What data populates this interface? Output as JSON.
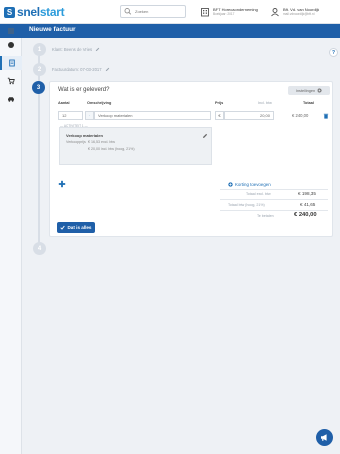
{
  "header": {
    "logo": {
      "part1": "snel",
      "part2": "start"
    },
    "search": {
      "placeholder": "Zoeken"
    },
    "company": {
      "name": "BFT Horecaonderneming",
      "sub": "Boekjaar: 2017"
    },
    "user": {
      "name": "Bft. Vd. van Noordijk",
      "sub": "mail.vdnoordijk@bft.nl"
    }
  },
  "title_bar": {
    "title": "Nieuwe factuur"
  },
  "sidebar": {
    "items": [
      {
        "icon": "menu-icon"
      },
      {
        "icon": "coin-icon"
      },
      {
        "icon": "document-icon"
      },
      {
        "icon": "cart-icon"
      },
      {
        "icon": "car-icon"
      }
    ]
  },
  "steps": [
    {
      "number": "1",
      "text": "Klant: Beens de Vries"
    },
    {
      "number": "2",
      "text": "Factuurdatum: 07-03-2017"
    },
    {
      "number": "3",
      "text": "Wat is er geleverd?"
    },
    {
      "number": "4",
      "text": ""
    }
  ],
  "card": {
    "settings_label": "Instellingen",
    "columns": {
      "qty": "Aantal",
      "description": "Omschrijving",
      "price": "Prijs",
      "price_sub": "Incl. btw",
      "total": "Totaal"
    },
    "line": {
      "qty": "12",
      "description": "Verkoop materialen",
      "currency": "€",
      "price": "20,00",
      "total": "€ 240,00"
    },
    "detail": {
      "group_label": "— ACTIVITEIT 1 —",
      "title": "Verkoop materialen",
      "row1_label": "Verkoopprijs",
      "row1_value": "€ 16,53 excl. btw",
      "row2_value": "€ 20,00 incl. btw (hoog, 21%)"
    },
    "discount_link": "Korting toevoegen",
    "totals": [
      {
        "label": "Totaal excl. btw",
        "value": "€ 198,35"
      },
      {
        "label": "Totaal btw (hoog, 21%)",
        "value": "€ 41,65"
      },
      {
        "label": "Te betalen",
        "value": "€ 240,00"
      }
    ],
    "done_label": "Dat is alles"
  },
  "help_label": "?",
  "colors": {
    "primary": "#1f5fa8",
    "accent": "#2d9cdb",
    "background": "#eef1f5"
  }
}
